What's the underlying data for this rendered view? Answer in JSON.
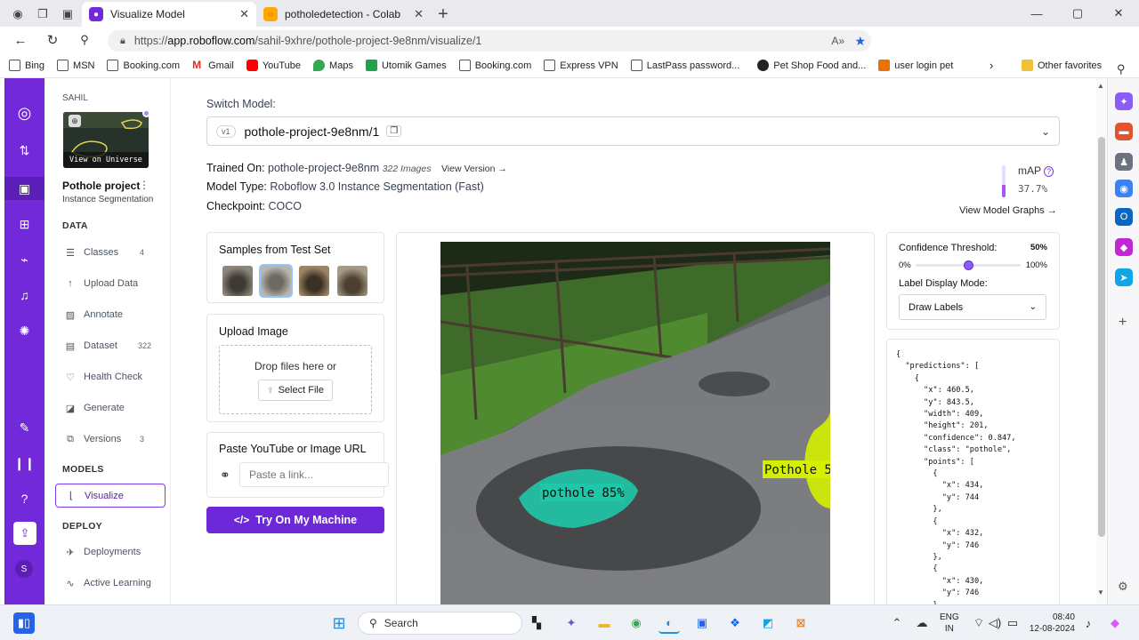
{
  "browser": {
    "tabs": [
      {
        "title": "Visualize Model",
        "active": true
      },
      {
        "title": "potholedetection - Colab",
        "active": false
      }
    ],
    "url_scheme": "https://",
    "url_host": "app.roboflow.com",
    "url_path": "/sahil-9xhre/pothole-project-9e8nm/visualize/1",
    "favorites": [
      "Bing",
      "MSN",
      "Booking.com",
      "Gmail",
      "YouTube",
      "Maps",
      "Utomik Games",
      "Booking.com",
      "Express VPN",
      "LastPass password...",
      "Pet Shop Food and...",
      "user login pet"
    ],
    "other_favorites": "Other favorites"
  },
  "sidebar": {
    "workspace": "SAHIL",
    "thumb_label": "View on Universe",
    "project_name": "Pothole project",
    "project_type": "Instance Segmentation",
    "data_heading": "DATA",
    "data_items": [
      {
        "label": "Classes",
        "count": "4"
      },
      {
        "label": "Upload Data",
        "count": ""
      },
      {
        "label": "Annotate",
        "count": ""
      },
      {
        "label": "Dataset",
        "count": "322"
      },
      {
        "label": "Health Check",
        "count": ""
      },
      {
        "label": "Generate",
        "count": ""
      },
      {
        "label": "Versions",
        "count": "3"
      }
    ],
    "models_heading": "MODELS",
    "models_item": "Visualize",
    "deploy_heading": "DEPLOY",
    "deploy_items": [
      "Deployments",
      "Active Learning"
    ]
  },
  "main": {
    "switch_label": "Switch Model:",
    "model_version": "v1",
    "model_name": "pothole-project-9e8nm/1",
    "trained_on_label": "Trained On:",
    "trained_on_value": "pothole-project-9e8nm",
    "images_count": "322 Images",
    "view_version": "View Version →",
    "model_type_label": "Model Type:",
    "model_type_value": "Roboflow 3.0 Instance Segmentation (Fast)",
    "checkpoint_label": "Checkpoint:",
    "checkpoint_value": "COCO",
    "map_label": "mAP",
    "map_value": "37.7%",
    "map_fraction": 0.377,
    "view_graphs": "View Model Graphs →"
  },
  "samples": {
    "title": "Samples from Test Set"
  },
  "upload": {
    "title": "Upload Image",
    "drop_text": "Drop files here or",
    "select_label": "Select File"
  },
  "paste": {
    "title": "Paste YouTube or Image URL",
    "placeholder": "Paste a link..."
  },
  "try_button": "Try On My Machine",
  "detections": [
    {
      "label": "pothole 85%"
    },
    {
      "label": "Pothole 5"
    }
  ],
  "controls": {
    "conf_label": "Confidence Threshold:",
    "conf_value": "50%",
    "conf_fraction": 0.5,
    "min": "0%",
    "max": "100%",
    "display_mode_label": "Label Display Mode:",
    "display_mode_value": "Draw Labels"
  },
  "json_lines": [
    "{",
    "  \"predictions\": [",
    "    {",
    "      \"x\": 460.5,",
    "      \"y\": 843.5,",
    "      \"width\": 409,",
    "      \"height\": 201,",
    "      \"confidence\": 0.847,",
    "      \"class\": \"pothole\",",
    "      \"points\": [",
    "        {",
    "          \"x\": 434,",
    "          \"y\": 744",
    "        },",
    "        {",
    "          \"x\": 432,",
    "          \"y\": 746",
    "        },",
    "        {",
    "          \"x\": 430,",
    "          \"y\": 746",
    "        },"
  ],
  "taskbar": {
    "search": "Search",
    "lang": "ENG",
    "region": "IN",
    "time": "08:40",
    "date": "12-08-2024"
  },
  "colors": {
    "brand": "#7229d9",
    "accent": "#6d28d9",
    "mask_teal": "#1fc7a8",
    "mask_yellow": "#d4f000"
  }
}
